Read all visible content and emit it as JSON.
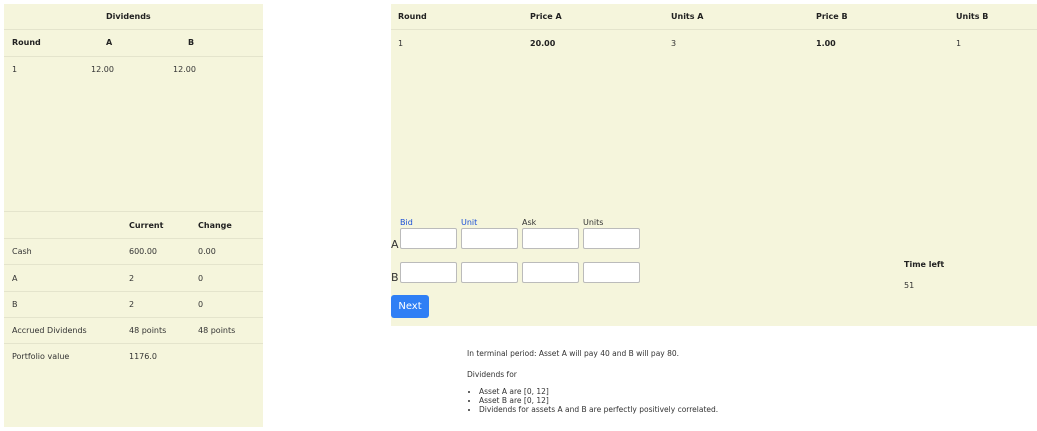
{
  "dividends_table": {
    "title": "Dividends",
    "headers": [
      "Round",
      "A",
      "B"
    ],
    "rows": [
      {
        "round": "1",
        "a": "12.00",
        "b": "12.00"
      }
    ]
  },
  "portfolio_table": {
    "headers": [
      "",
      "Current",
      "Change"
    ],
    "rows": [
      {
        "label": "Cash",
        "current": "600.00",
        "change": "0.00"
      },
      {
        "label": "A",
        "current": "2",
        "change": "0"
      },
      {
        "label": "B",
        "current": "2",
        "change": "0"
      },
      {
        "label": "Accrued Dividends",
        "current": "48 points",
        "change": "48 points"
      },
      {
        "label": "Portfolio value",
        "current": "1176.0",
        "change": ""
      }
    ]
  },
  "market_table": {
    "headers": [
      "Round",
      "Price A",
      "Units A",
      "Price B",
      "Units B"
    ],
    "rows": [
      {
        "round": "1",
        "price_a": "20.00",
        "units_a": "3",
        "price_b": "1.00",
        "units_b": "1"
      }
    ]
  },
  "order_form": {
    "column_labels": [
      "Bid",
      "Unit",
      "Ask",
      "Units"
    ],
    "row_labels": [
      "A",
      "B"
    ],
    "values": {
      "a": [
        "",
        "",
        "",
        ""
      ],
      "b": [
        "",
        "",
        "",
        ""
      ]
    }
  },
  "timer": {
    "label": "Time left",
    "value": "51"
  },
  "next_button": "Next",
  "info": {
    "terminal": "In terminal period: Asset A will pay 40 and B will pay 80.",
    "dividends_for": "Dividends for",
    "bullets": [
      "Asset A are [0, 12]",
      "Asset B are [0, 12]",
      "Dividends for assets A and B are perfectly positively correlated."
    ]
  },
  "colors": {
    "panel_bg": "#f5f5dc",
    "button": "#2f7ff5",
    "link_blue": "#1a4fd6"
  }
}
